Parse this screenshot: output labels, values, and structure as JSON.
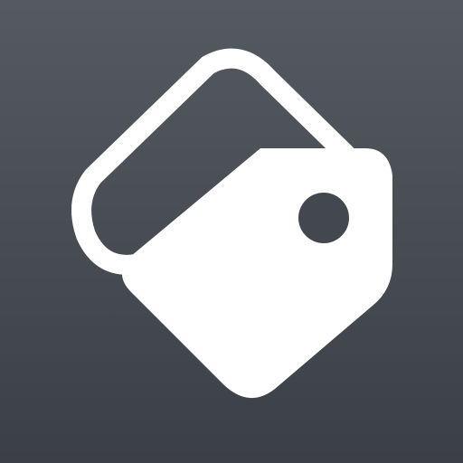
{
  "app_icon": {
    "icon_name": "price-tag-icon",
    "background_colors": [
      "#555a61",
      "#3b3f46"
    ],
    "tag_color": "#ffffff",
    "hole_color": "#43474e"
  }
}
